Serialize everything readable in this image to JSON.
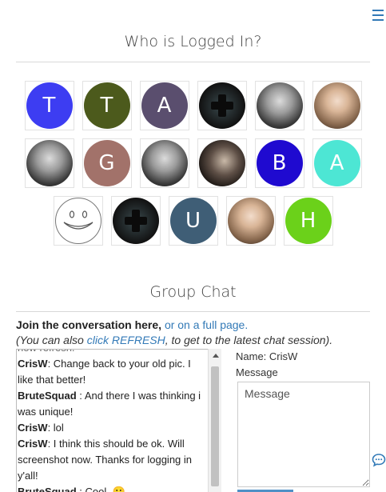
{
  "header": {
    "menu_icon": "hamburger-menu-icon"
  },
  "logged_in": {
    "title": "Who is Logged In?",
    "rows": [
      [
        {
          "type": "letter",
          "letter": "T",
          "color": "#3d3df2"
        },
        {
          "type": "letter",
          "letter": "T",
          "color": "#4c5a1c"
        },
        {
          "type": "letter",
          "letter": "A",
          "color": "#5a4e6e"
        },
        {
          "type": "icon",
          "icon": "plus-cross-icon"
        },
        {
          "type": "photo",
          "style": "photo"
        },
        {
          "type": "photo",
          "style": "photo warm"
        }
      ],
      [
        {
          "type": "photo",
          "style": "photo"
        },
        {
          "type": "letter",
          "letter": "G",
          "color": "#a2726a"
        },
        {
          "type": "photo",
          "style": "photo"
        },
        {
          "type": "photo",
          "style": "photo dark"
        },
        {
          "type": "letter",
          "letter": "B",
          "color": "#1f0ad0"
        },
        {
          "type": "letter",
          "letter": "A",
          "color": "#4de6d4"
        }
      ],
      [
        {
          "type": "icon",
          "icon": "smiley-face-icon"
        },
        {
          "type": "icon",
          "icon": "plus-cross-icon"
        },
        {
          "type": "letter",
          "letter": "U",
          "color": "#3f5e76"
        },
        {
          "type": "photo",
          "style": "photo warm"
        },
        {
          "type": "letter",
          "letter": "H",
          "color": "#6bd11a"
        }
      ]
    ]
  },
  "group_chat": {
    "title": "Group Chat",
    "join_text": "Join the conversation here, ",
    "join_link": "or on a full page.",
    "hint_prefix": "(You can also ",
    "hint_link": "click REFRESH",
    "hint_suffix": ", to get to the latest chat session).",
    "partial_top_line": "now refresh.",
    "messages": [
      {
        "user": "CrisW",
        "text": "Change back to your old pic. I like that better!"
      },
      {
        "user": "BruteSquad ",
        "text": "And there I was thinking i was unique!"
      },
      {
        "user": "CrisW",
        "text": "lol"
      },
      {
        "user": "CrisW",
        "text": "I think this should be ok. Will screenshot now. Thanks for logging in y'all!"
      },
      {
        "user": "BruteSquad ",
        "text": "Cool. 🙂"
      }
    ],
    "name_label": "Name: CrisW",
    "message_label": "Message",
    "message_placeholder": "Message",
    "chat_icon": "speech-bubble-icon"
  }
}
